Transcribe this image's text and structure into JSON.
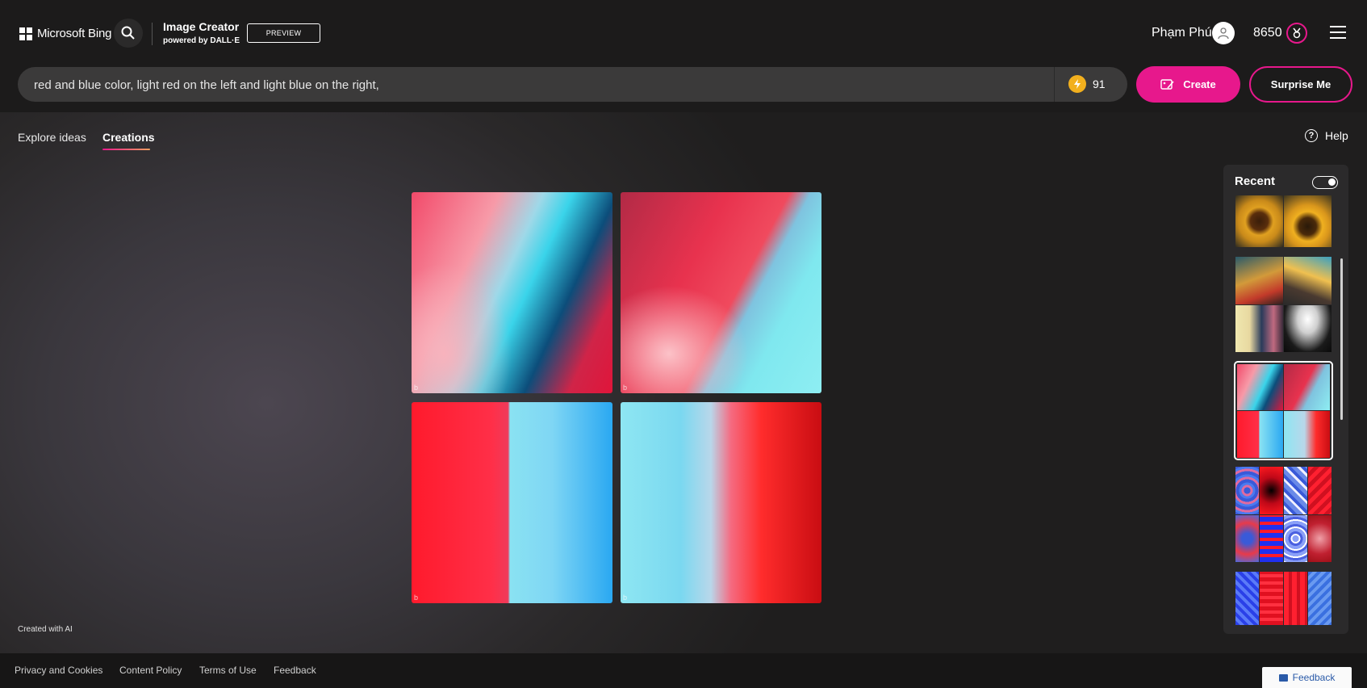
{
  "header": {
    "brand": "Microsoft Bing",
    "app_title": "Image Creator",
    "app_subtitle": "powered by DALL·E",
    "badge": "PREVIEW",
    "user_name": "Phạm Phú",
    "points": "8650"
  },
  "prompt": {
    "value": "red and blue color, light red on the left and light blue on the right,",
    "boosts": "91",
    "create_label": "Create",
    "surprise_label": "Surprise Me"
  },
  "tabs": [
    {
      "label": "Explore ideas",
      "active": false
    },
    {
      "label": "Creations",
      "active": true
    }
  ],
  "help_label": "Help",
  "created_with_ai": "Created with AI",
  "recent": {
    "title": "Recent",
    "toggle_on": true
  },
  "footer": {
    "links": [
      "Privacy and Cookies",
      "Content Policy",
      "Terms of Use",
      "Feedback"
    ],
    "feedback_button": "Feedback"
  },
  "colors": {
    "accent": "#e7188c",
    "background": "#1b1a1a"
  }
}
